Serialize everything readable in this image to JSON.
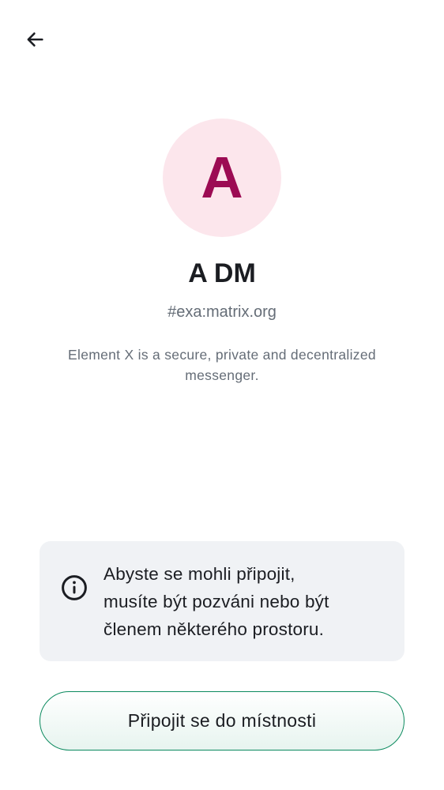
{
  "header": {
    "back_icon": "arrow-left-icon"
  },
  "room": {
    "avatar_letter": "A",
    "name": "A DM",
    "alias": "#exa:matrix.org",
    "topic": "Element X is a secure, private and decentralized messenger."
  },
  "notice": {
    "icon": "info-icon",
    "text_line1": "Abyste se mohli připojit,",
    "text_line2": "musíte být pozváni nebo být",
    "text_line3": "členem některého prostoru."
  },
  "actions": {
    "join_label": "Připojit se do místnosti"
  },
  "colors": {
    "avatar_bg": "#fce6ec",
    "avatar_fg": "#9c0b53",
    "accent": "#0b8a5e",
    "card_bg": "#f0f2f5"
  }
}
